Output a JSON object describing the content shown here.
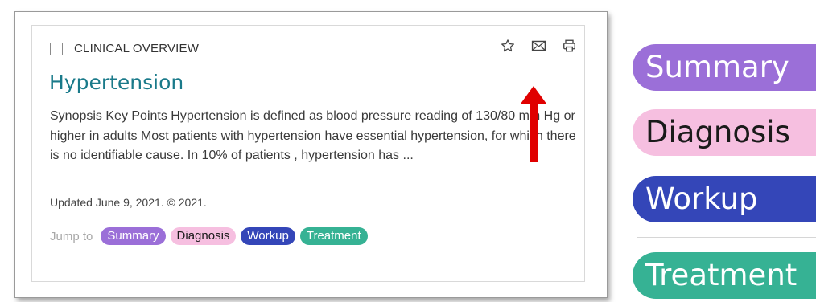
{
  "card": {
    "overline": "CLINICAL OVERVIEW",
    "title": "Hypertension",
    "synopsis": "Synopsis Key Points Hypertension is defined as blood pressure reading of 130/80 mm Hg or higher in adults Most patients with hypertension have essential hypertension, for which there is no identifiable cause. In 10% of patients , hypertension has ...",
    "updated": "Updated June 9, 2021. © 2021.",
    "jump_label": "Jump to",
    "actions": [
      "star-icon",
      "mail-icon",
      "print-icon"
    ]
  },
  "pills": [
    {
      "label": "Summary",
      "bg": "#9b6fd8",
      "fg": "#ffffff"
    },
    {
      "label": "Diagnosis",
      "bg": "#f6bfe0",
      "fg": "#1a1a1a"
    },
    {
      "label": "Workup",
      "bg": "#3446b8",
      "fg": "#ffffff"
    },
    {
      "label": "Treatment",
      "bg": "#36b294",
      "fg": "#ffffff"
    }
  ],
  "zoomed_pills": [
    {
      "label": "Summary"
    },
    {
      "label": "Diagnosis"
    },
    {
      "label": "Workup"
    },
    {
      "label": "Treatment"
    }
  ],
  "annotation": {
    "arrow_color": "#e00000"
  }
}
